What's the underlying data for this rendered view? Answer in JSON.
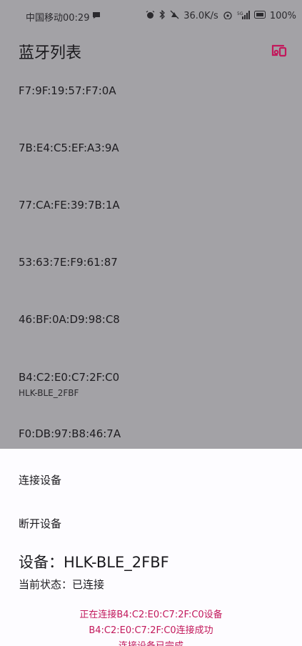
{
  "status_bar": {
    "carrier_time": "中国移动00:29",
    "network_speed": "36.0K/s",
    "signal_text": "5G",
    "battery": "100%"
  },
  "app_bar": {
    "title": "蓝牙列表",
    "action_icon": "devices-icon"
  },
  "devices": [
    {
      "mac": "F7:9F:19:57:F7:0A",
      "name": ""
    },
    {
      "mac": "7B:E4:C5:EF:A3:9A",
      "name": ""
    },
    {
      "mac": "77:CA:FE:39:7B:1A",
      "name": ""
    },
    {
      "mac": "53:63:7E:F9:61:87",
      "name": ""
    },
    {
      "mac": "46:BF:0A:D9:98:C8",
      "name": ""
    },
    {
      "mac": "B4:C2:E0:C7:2F:C0",
      "name": "HLK-BLE_2FBF"
    },
    {
      "mac": "F0:DB:97:B8:46:7A",
      "name": ""
    }
  ],
  "sheet": {
    "connect_label": "连接设备",
    "disconnect_label": "断开设备",
    "device_label": "设备：HLK-BLE_2FBF",
    "status_label": "当前状态：已连接",
    "log": [
      "正在连接B4:C2:E0:C7:2F:C0设备",
      "B4:C2:E0:C7:2F:C0连接成功",
      "连接设备已完成"
    ]
  },
  "colors": {
    "scrim_background": "#a3a2a6",
    "sheet_background": "#fdfcff",
    "accent": "#c2185b"
  }
}
